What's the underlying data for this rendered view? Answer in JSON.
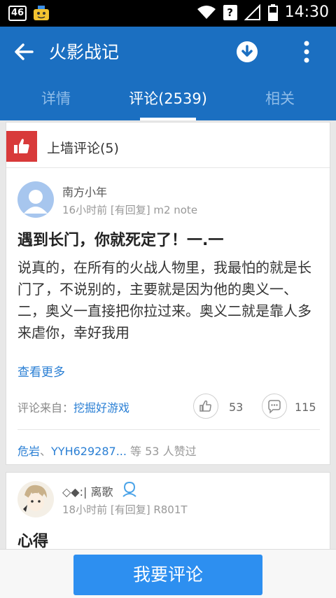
{
  "status_bar": {
    "network": "46",
    "time": "14:30",
    "indicator": "?"
  },
  "app_bar": {
    "title": "火影战记"
  },
  "tabs": [
    {
      "label": "详情",
      "active": false
    },
    {
      "label": "评论(2539)",
      "active": true
    },
    {
      "label": "相关",
      "active": false
    }
  ],
  "section": {
    "title": "上墙评论(5)"
  },
  "comment1": {
    "user": "南方小年",
    "meta": "16小时前 [有回复]   m2 note",
    "title": "遇到长门，你就死定了！一.一",
    "body": "说真的，在所有的火战人物里，我最怕的就是长门了，不说别的，主要就是因为他的奥义一、二，奥义一直接把你拉过来。奥义二就是靠人多来虐你，幸好我用",
    "see_more": "查看更多",
    "source_label": "评论来自：",
    "source_link": "挖掘好游戏",
    "like_count": "53",
    "reply_count": "115",
    "liker1": "危岩",
    "sep_text": "、",
    "liker2": "YYH629287...",
    "likers_suffix": " 等 53 人赞过"
  },
  "comment2": {
    "user": "◇◆:| 离歌",
    "meta": "18小时前 [有回复]   R801T",
    "title": "心得"
  },
  "bottom": {
    "comment_button": "我要评论"
  },
  "colors": {
    "primary": "#1b6fc1",
    "button": "#2d8ff0",
    "link": "#2a7fd4",
    "thumb_bg": "#d83a3a"
  }
}
